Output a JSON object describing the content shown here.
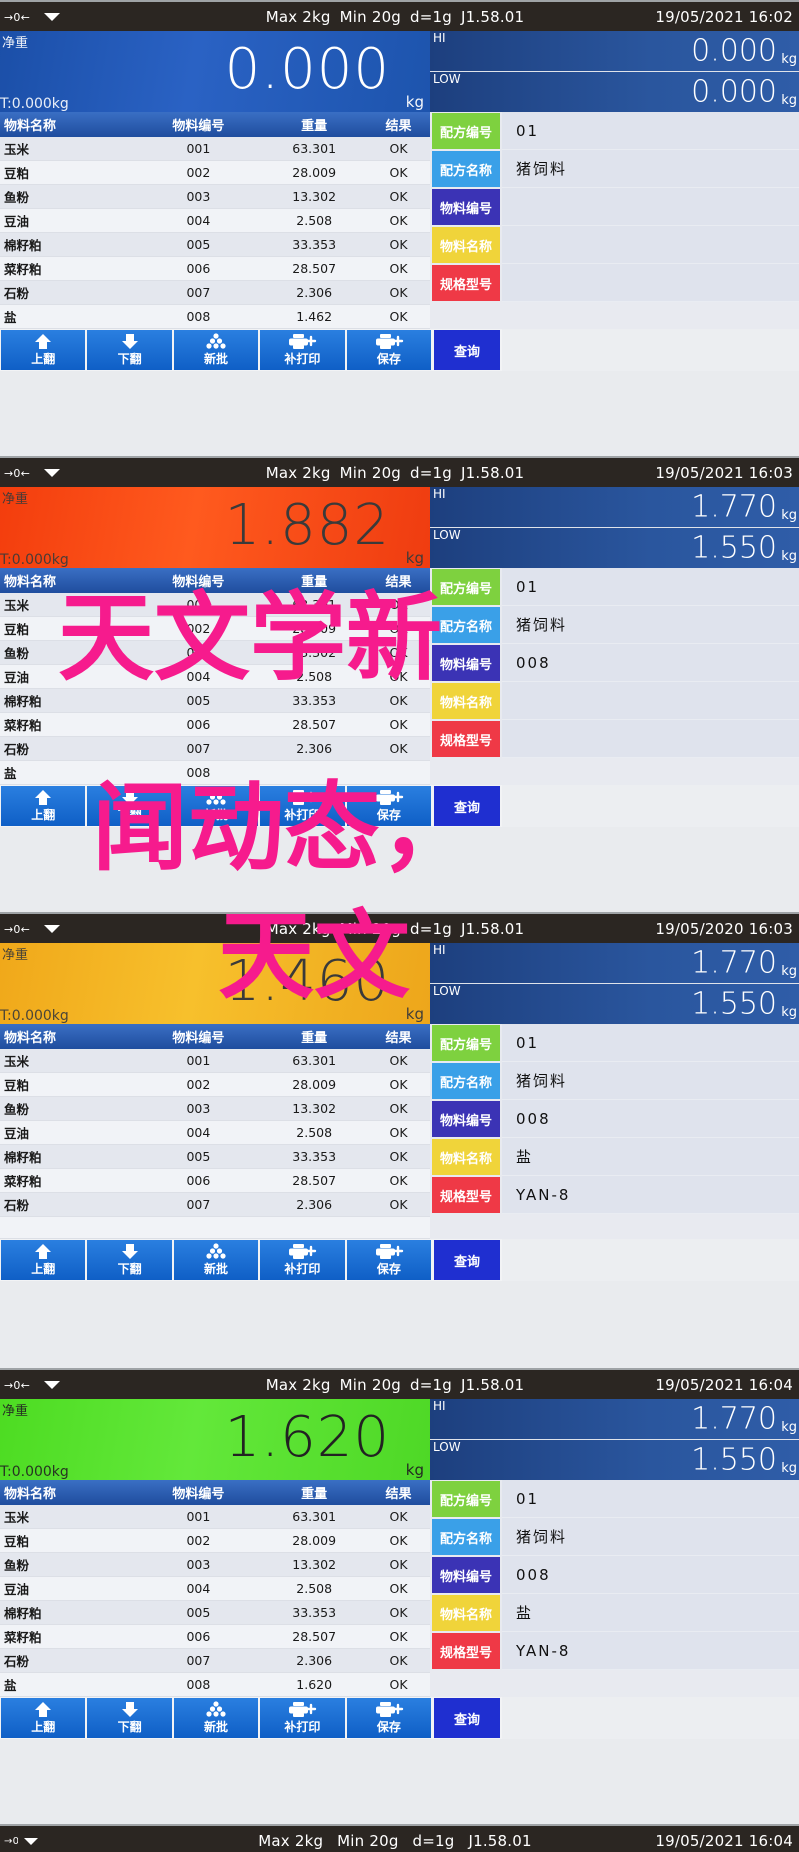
{
  "watermark": {
    "line1": "天文学新",
    "line2": "闻动态，",
    "line3": "天文",
    "color": "#f61b8d"
  },
  "status_common": {
    "max": "Max 2kg",
    "min": "Min 20g",
    "division": "d=1g",
    "version": "J1.58.01"
  },
  "table": {
    "headers": [
      "物料名称",
      "物料编号",
      "重量",
      "结果"
    ]
  },
  "labels": {
    "net": "净重",
    "tare": "T:0.000kg",
    "kg": "kg",
    "hi": "HI",
    "low": "LOW",
    "recipe_no": "配方编号",
    "recipe_name": "配方名称",
    "material_no": "物料编号",
    "material_name": "物料名称",
    "spec_model": "规格型号"
  },
  "toolbar": {
    "page_up": "上翻",
    "page_down": "下翻",
    "new_batch": "新批",
    "reprint": "补打印",
    "save": "保存",
    "query": "查询"
  },
  "panels": [
    {
      "datetime": "19/05/2021  16:02",
      "weight": "0.000",
      "weight_state": "blue",
      "hi": "0.000",
      "low": "0.000",
      "rows": [
        {
          "name": "玉米",
          "no": "001",
          "weight": "63.301",
          "result": "OK"
        },
        {
          "name": "豆粕",
          "no": "002",
          "weight": "28.009",
          "result": "OK"
        },
        {
          "name": "鱼粉",
          "no": "003",
          "weight": "13.302",
          "result": "OK"
        },
        {
          "name": "豆油",
          "no": "004",
          "weight": "2.508",
          "result": "OK"
        },
        {
          "name": "棉籽粕",
          "no": "005",
          "weight": "33.353",
          "result": "OK"
        },
        {
          "name": "菜籽粕",
          "no": "006",
          "weight": "28.507",
          "result": "OK"
        },
        {
          "name": "石粉",
          "no": "007",
          "weight": "2.306",
          "result": "OK"
        },
        {
          "name": "盐",
          "no": "008",
          "weight": "1.462",
          "result": "OK"
        }
      ],
      "form": {
        "recipe_no": "01",
        "recipe_name": "猪饲料",
        "material_no": "",
        "material_name": "",
        "spec_model": ""
      }
    },
    {
      "datetime": "19/05/2021  16:03",
      "weight": "1.882",
      "weight_state": "red",
      "hi": "1.770",
      "low": "1.550",
      "rows": [
        {
          "name": "玉米",
          "no": "001",
          "weight": "63.301",
          "result": "OK"
        },
        {
          "name": "豆粕",
          "no": "002",
          "weight": "28.009",
          "result": "OK"
        },
        {
          "name": "鱼粉",
          "no": "003",
          "weight": "13.302",
          "result": "OK"
        },
        {
          "name": "豆油",
          "no": "004",
          "weight": "2.508",
          "result": "OK"
        },
        {
          "name": "棉籽粕",
          "no": "005",
          "weight": "33.353",
          "result": "OK"
        },
        {
          "name": "菜籽粕",
          "no": "006",
          "weight": "28.507",
          "result": "OK"
        },
        {
          "name": "石粉",
          "no": "007",
          "weight": "2.306",
          "result": "OK"
        },
        {
          "name": "盐",
          "no": "008",
          "weight": "",
          "result": ""
        }
      ],
      "form": {
        "recipe_no": "01",
        "recipe_name": "猪饲料",
        "material_no": "008",
        "material_name": "",
        "spec_model": ""
      }
    },
    {
      "datetime": "19/05/2020  16:03",
      "weight": "1.460",
      "weight_state": "orange",
      "hi": "1.770",
      "low": "1.550",
      "rows": [
        {
          "name": "玉米",
          "no": "001",
          "weight": "63.301",
          "result": "OK"
        },
        {
          "name": "豆粕",
          "no": "002",
          "weight": "28.009",
          "result": "OK"
        },
        {
          "name": "鱼粉",
          "no": "003",
          "weight": "13.302",
          "result": "OK"
        },
        {
          "name": "豆油",
          "no": "004",
          "weight": "2.508",
          "result": "OK"
        },
        {
          "name": "棉籽粕",
          "no": "005",
          "weight": "33.353",
          "result": "OK"
        },
        {
          "name": "菜籽粕",
          "no": "006",
          "weight": "28.507",
          "result": "OK"
        },
        {
          "name": "石粉",
          "no": "007",
          "weight": "2.306",
          "result": "OK"
        },
        {
          "name": "",
          "no": "",
          "weight": "",
          "result": ""
        }
      ],
      "form": {
        "recipe_no": "01",
        "recipe_name": "猪饲料",
        "material_no": "008",
        "material_name": "盐",
        "spec_model": "YAN-8"
      }
    },
    {
      "datetime": "19/05/2021  16:04",
      "weight": "1.620",
      "weight_state": "green",
      "hi": "1.770",
      "low": "1.550",
      "rows": [
        {
          "name": "玉米",
          "no": "001",
          "weight": "63.301",
          "result": "OK"
        },
        {
          "name": "豆粕",
          "no": "002",
          "weight": "28.009",
          "result": "OK"
        },
        {
          "name": "鱼粉",
          "no": "003",
          "weight": "13.302",
          "result": "OK"
        },
        {
          "name": "豆油",
          "no": "004",
          "weight": "2.508",
          "result": "OK"
        },
        {
          "name": "棉籽粕",
          "no": "005",
          "weight": "33.353",
          "result": "OK"
        },
        {
          "name": "菜籽粕",
          "no": "006",
          "weight": "28.507",
          "result": "OK"
        },
        {
          "name": "石粉",
          "no": "007",
          "weight": "2.306",
          "result": "OK"
        },
        {
          "name": "盐",
          "no": "008",
          "weight": "1.620",
          "result": "OK"
        }
      ],
      "form": {
        "recipe_no": "01",
        "recipe_name": "猪饲料",
        "material_no": "008",
        "material_name": "盐",
        "spec_model": "YAN-8"
      }
    }
  ],
  "bottom_strip": {
    "datetime": "19/05/2021  16:04"
  }
}
